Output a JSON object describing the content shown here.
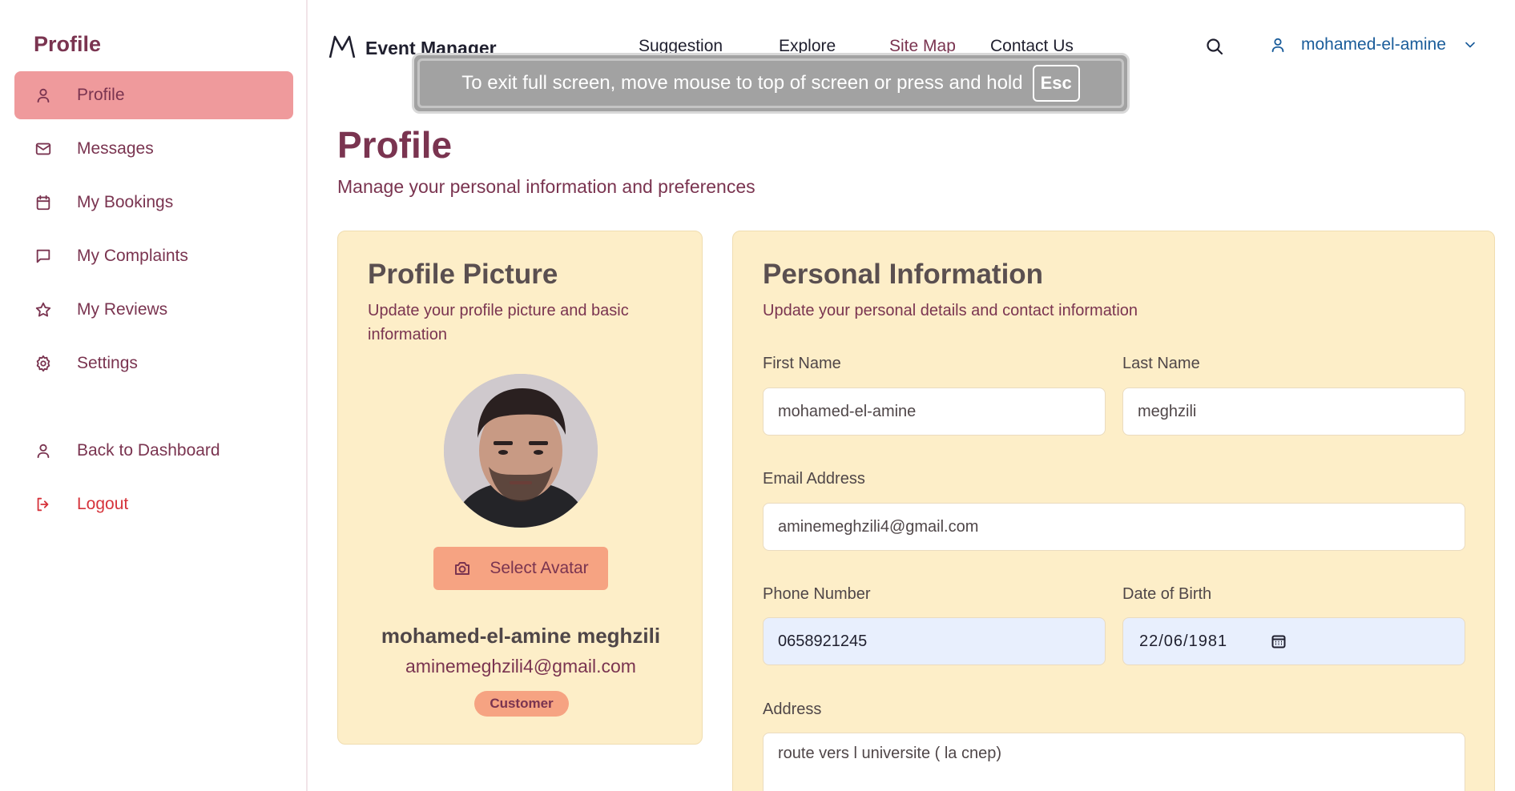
{
  "sidebar": {
    "title": "Profile",
    "items": [
      {
        "label": "Profile",
        "icon": "user-icon",
        "active": true
      },
      {
        "label": "Messages",
        "icon": "mail-icon"
      },
      {
        "label": "My Bookings",
        "icon": "calendar-icon"
      },
      {
        "label": "My Complaints",
        "icon": "message-square-icon"
      },
      {
        "label": "My Reviews",
        "icon": "star-icon"
      },
      {
        "label": "Settings",
        "icon": "gear-icon"
      },
      {
        "label": "Back to Dashboard",
        "icon": "user-icon"
      },
      {
        "label": "Logout",
        "icon": "logout-icon"
      }
    ]
  },
  "header": {
    "brand": "Event Manager",
    "nav": [
      "Suggestion",
      "Explore",
      "Site Map",
      "Contact Us"
    ],
    "active_nav": "Site Map",
    "user": "mohamed-el-amine"
  },
  "fullscreen_toast": {
    "message": "To exit full screen, move mouse to top of screen or press and hold",
    "key": "Esc"
  },
  "page": {
    "title": "Profile",
    "subtitle": "Manage your personal information and preferences"
  },
  "profile_picture": {
    "title": "Profile Picture",
    "description": "Update your profile picture and basic information",
    "select_avatar_label": "Select Avatar",
    "full_name": "mohamed-el-amine meghzili",
    "email": "aminemeghzili4@gmail.com",
    "role": "Customer"
  },
  "personal_info": {
    "title": "Personal Information",
    "description": "Update your personal details and contact information",
    "first_name_label": "First Name",
    "first_name": "mohamed-el-amine",
    "last_name_label": "Last Name",
    "last_name": "meghzili",
    "email_label": "Email Address",
    "email": "aminemeghzili4@gmail.com",
    "phone_label": "Phone Number",
    "phone": "0658921245",
    "dob_label": "Date of Birth",
    "dob": "22/06/1981",
    "address_label": "Address",
    "address": "route vers l universite ( la cnep)"
  },
  "colors": {
    "accent": "#7a3450",
    "active_item_bg": "#ef9a9c",
    "card_bg": "#fdeec8",
    "button_bg": "#f6a382",
    "user_link": "#1a5c9a",
    "logout": "#d6333b"
  }
}
